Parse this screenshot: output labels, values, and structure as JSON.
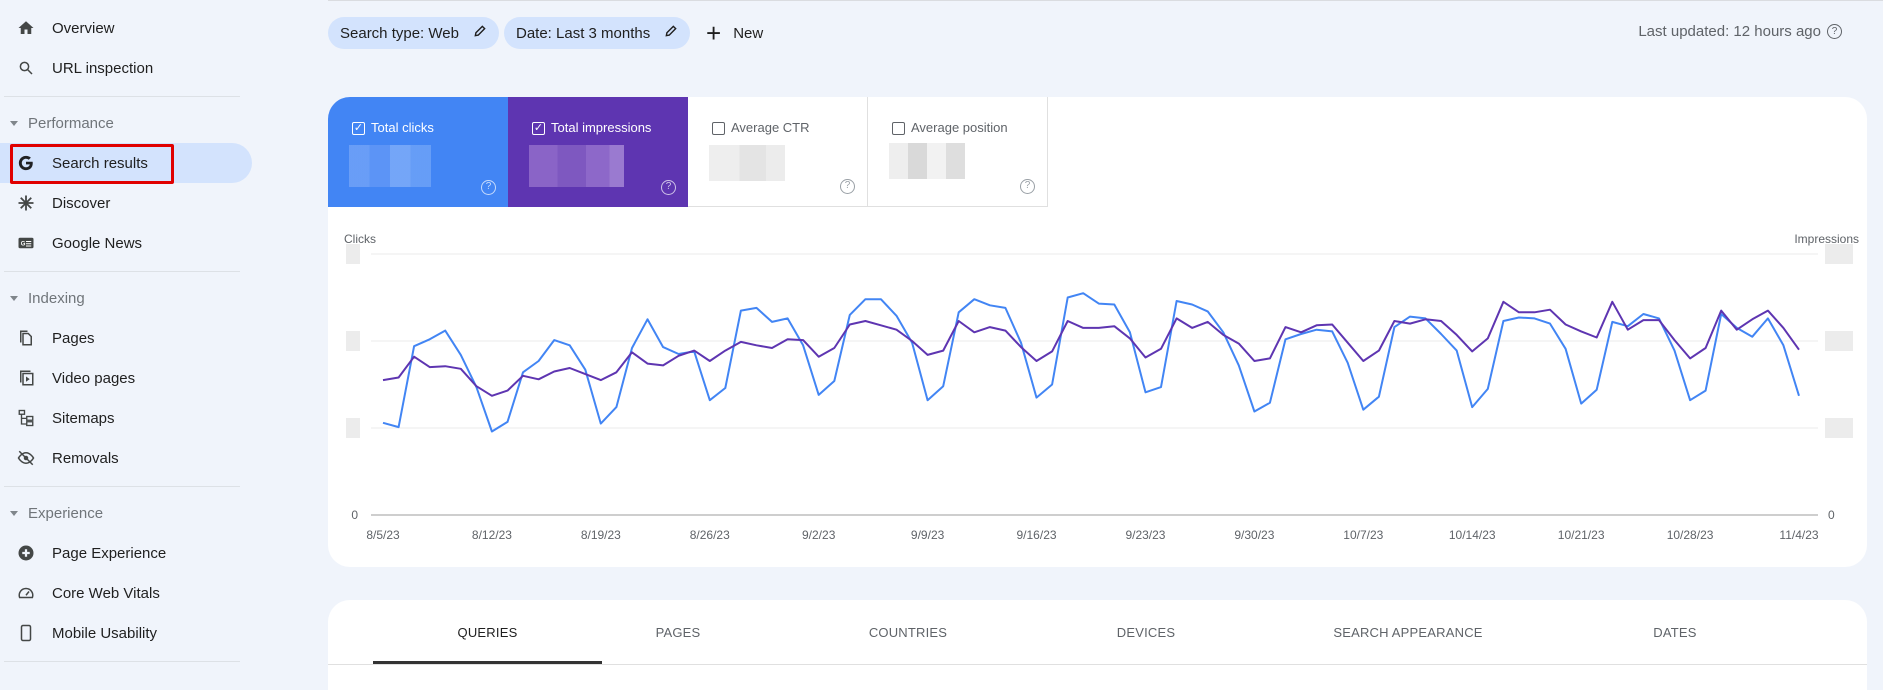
{
  "sidebar": {
    "top_items": [
      {
        "label": "Overview",
        "icon": "home-icon"
      },
      {
        "label": "URL inspection",
        "icon": "search-icon"
      }
    ],
    "sections": [
      {
        "title": "Performance",
        "items": [
          {
            "label": "Search results",
            "icon": "google-g-icon",
            "active": true
          },
          {
            "label": "Discover",
            "icon": "asterisk-icon"
          },
          {
            "label": "Google News",
            "icon": "google-news-icon"
          }
        ]
      },
      {
        "title": "Indexing",
        "items": [
          {
            "label": "Pages",
            "icon": "pages-icon"
          },
          {
            "label": "Video pages",
            "icon": "video-pages-icon"
          },
          {
            "label": "Sitemaps",
            "icon": "sitemap-icon"
          },
          {
            "label": "Removals",
            "icon": "eye-off-icon"
          }
        ]
      },
      {
        "title": "Experience",
        "items": [
          {
            "label": "Page Experience",
            "icon": "plus-circle-icon"
          },
          {
            "label": "Core Web Vitals",
            "icon": "gauge-icon"
          },
          {
            "label": "Mobile Usability",
            "icon": "phone-icon"
          }
        ]
      }
    ]
  },
  "filters": {
    "chips": [
      {
        "label": "Search type: Web",
        "icon": "pencil-icon"
      },
      {
        "label": "Date: Last 3 months",
        "icon": "pencil-icon"
      }
    ],
    "new_label": "New",
    "last_updated": "Last updated: 12 hours ago"
  },
  "metrics": [
    {
      "label": "Total clicks",
      "checked": true,
      "value": "",
      "color": "#4285f4"
    },
    {
      "label": "Total impressions",
      "checked": true,
      "value": "",
      "color": "#5e35b1"
    },
    {
      "label": "Average CTR",
      "checked": false,
      "value": ""
    },
    {
      "label": "Average position",
      "checked": false,
      "value": ""
    }
  ],
  "tabs": [
    {
      "label": "QUERIES",
      "active": true
    },
    {
      "label": "PAGES"
    },
    {
      "label": "COUNTRIES"
    },
    {
      "label": "DEVICES"
    },
    {
      "label": "SEARCH APPEARANCE"
    },
    {
      "label": "DATES"
    }
  ],
  "chart_data": {
    "type": "line",
    "title": "",
    "ylabel_left": "Clicks",
    "ylabel_right": "Impressions",
    "y_tick_labels_left": [
      "0",
      "",
      "",
      ""
    ],
    "y_tick_labels_right": [
      "0",
      "",
      "",
      ""
    ],
    "y_units_note": "tick values redacted; series values expressed in gridline units (0-3)",
    "ylim": [
      0,
      3
    ],
    "grid": true,
    "x_start": "8/5/23",
    "x_end": "11/4/23",
    "x_tick_labels": [
      "8/5/23",
      "8/12/23",
      "8/19/23",
      "8/26/23",
      "9/2/23",
      "9/9/23",
      "9/16/23",
      "9/23/23",
      "9/30/23",
      "10/7/23",
      "10/14/23",
      "10/21/23",
      "10/28/23",
      "11/4/23"
    ],
    "series": [
      {
        "name": "Clicks",
        "color": "#4285f4",
        "values": [
          1.06,
          1.01,
          1.94,
          2.02,
          2.12,
          1.84,
          1.47,
          0.96,
          1.07,
          1.64,
          1.77,
          2.01,
          1.95,
          1.67,
          1.05,
          1.24,
          1.92,
          2.25,
          1.93,
          1.85,
          1.88,
          1.32,
          1.46,
          2.35,
          2.38,
          2.22,
          2.26,
          1.95,
          1.38,
          1.54,
          2.3,
          2.48,
          2.48,
          2.29,
          1.98,
          1.32,
          1.48,
          2.33,
          2.48,
          2.41,
          2.38,
          1.98,
          1.35,
          1.5,
          2.5,
          2.55,
          2.43,
          2.42,
          2.1,
          1.41,
          1.47,
          2.46,
          2.42,
          2.34,
          2.1,
          1.72,
          1.19,
          1.29,
          2.02,
          2.08,
          2.13,
          2.11,
          1.75,
          1.21,
          1.36,
          2.16,
          2.28,
          2.26,
          2.08,
          1.89,
          1.24,
          1.45,
          2.23,
          2.27,
          2.26,
          2.2,
          1.91,
          1.28,
          1.44,
          2.22,
          2.17,
          2.31,
          2.26,
          1.89,
          1.32,
          1.43,
          2.31,
          2.15,
          2.05,
          2.26,
          1.95,
          1.37
        ]
      },
      {
        "name": "Impressions",
        "color": "#5e35b1",
        "values": [
          1.55,
          1.58,
          1.82,
          1.7,
          1.71,
          1.68,
          1.48,
          1.37,
          1.43,
          1.6,
          1.56,
          1.65,
          1.69,
          1.62,
          1.55,
          1.64,
          1.87,
          1.74,
          1.72,
          1.83,
          1.89,
          1.77,
          1.89,
          1.99,
          1.95,
          1.92,
          2.02,
          2.01,
          1.82,
          1.92,
          2.19,
          2.23,
          2.18,
          2.13,
          2.0,
          1.84,
          1.89,
          2.23,
          2.1,
          2.16,
          2.12,
          1.93,
          1.77,
          1.88,
          2.23,
          2.15,
          2.15,
          2.17,
          2.03,
          1.81,
          1.91,
          2.26,
          2.15,
          2.22,
          2.07,
          1.97,
          1.77,
          1.8,
          2.16,
          2.1,
          2.18,
          2.19,
          1.98,
          1.77,
          1.89,
          2.23,
          2.2,
          2.25,
          2.23,
          2.07,
          1.88,
          2.03,
          2.45,
          2.33,
          2.33,
          2.36,
          2.19,
          2.11,
          2.04,
          2.45,
          2.13,
          2.24,
          2.24,
          2.01,
          1.8,
          1.92,
          2.35,
          2.13,
          2.25,
          2.35,
          2.15,
          1.9
        ]
      }
    ]
  }
}
